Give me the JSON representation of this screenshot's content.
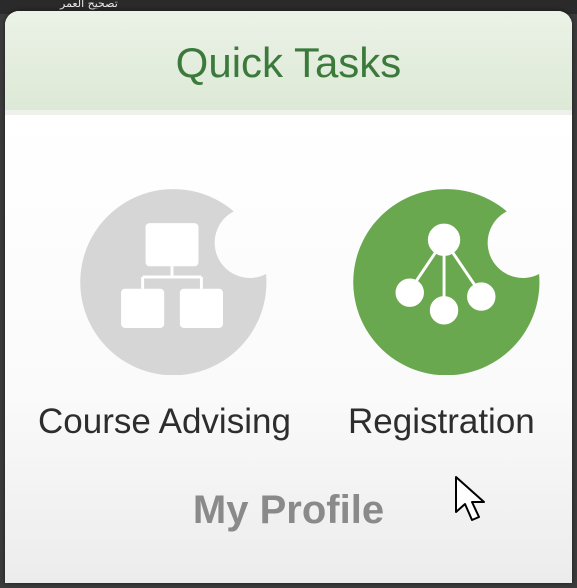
{
  "top_strip": {
    "text": "تصحيح العمر"
  },
  "header": {
    "title": "Quick Tasks"
  },
  "tasks": [
    {
      "label": "Course Advising",
      "color": "#d6d6d6",
      "icon": "flowchart-icon"
    },
    {
      "label": "Registration",
      "color": "#6aa84f",
      "icon": "hierarchy-icon"
    }
  ],
  "profile": {
    "label": "My Profile"
  },
  "colors": {
    "title_green": "#3c7a3c",
    "header_bg": "#e3eddf",
    "active_green": "#6aa84f",
    "inactive_gray": "#d6d6d6"
  }
}
